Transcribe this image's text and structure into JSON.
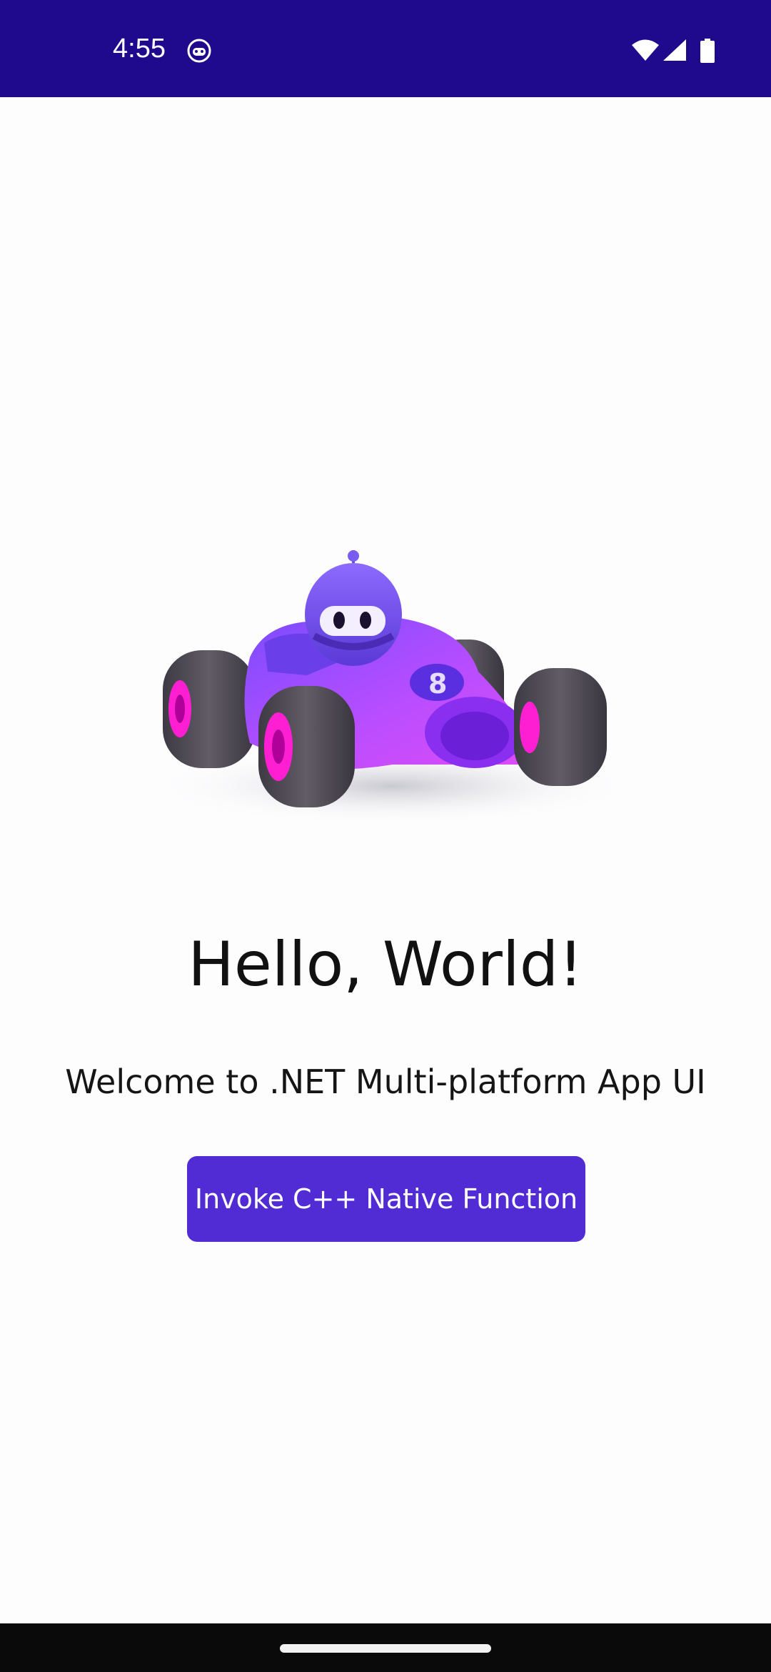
{
  "status_bar": {
    "time": "4:55",
    "app_icon": "app-notification-icon",
    "wifi_icon": "wifi-icon",
    "signal_icon": "cell-signal-icon",
    "battery_icon": "battery-icon",
    "background_color": "#1f0a8e"
  },
  "main": {
    "hero_image": "race-car-robot-illustration",
    "title": "Hello, World!",
    "subtitle": "Welcome to .NET Multi-platform App UI",
    "button_label": "Invoke C++ Native Function",
    "button_color": "#512bd4"
  },
  "navigation": {
    "home_handle": "gesture-home-handle"
  }
}
